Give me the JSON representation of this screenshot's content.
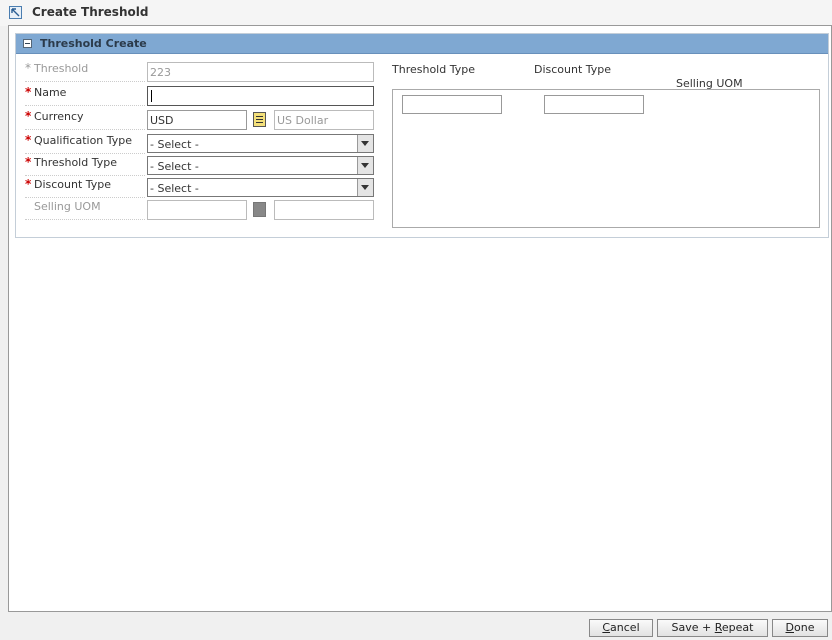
{
  "window": {
    "title": "Create Threshold"
  },
  "panel": {
    "title": "Threshold Create"
  },
  "form": {
    "threshold": {
      "label": "Threshold",
      "value": "223"
    },
    "name": {
      "label": "Name",
      "value": ""
    },
    "currency": {
      "label": "Currency",
      "code": "USD",
      "description": "US Dollar"
    },
    "qualification_type": {
      "label": "Qualification Type",
      "selected": "- Select -"
    },
    "threshold_type": {
      "label": "Threshold Type",
      "selected": "- Select -"
    },
    "discount_type": {
      "label": "Discount Type",
      "selected": "- Select -"
    },
    "selling_uom": {
      "label": "Selling UOM",
      "value": "",
      "description": ""
    },
    "required_marker": "*"
  },
  "table": {
    "columns": [
      "Threshold Type",
      "Discount Type",
      "Selling UOM"
    ]
  },
  "buttons": {
    "cancel": {
      "ul": "C",
      "rest": "ancel"
    },
    "save_repeat": {
      "pre": "Save + ",
      "ul": "R",
      "rest": "epeat"
    },
    "done": {
      "ul": "D",
      "rest": "one"
    }
  }
}
